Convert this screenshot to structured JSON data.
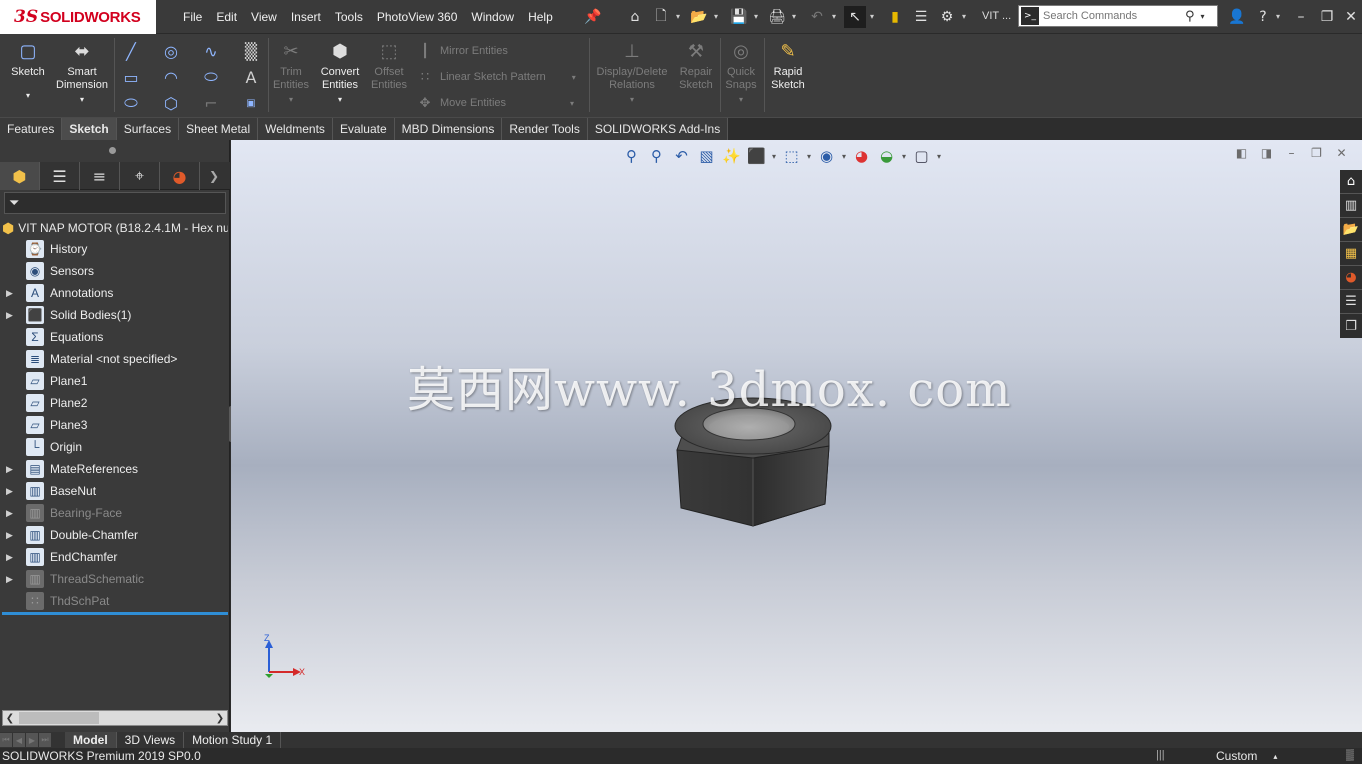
{
  "app": {
    "logo_ds": "3S",
    "logo_name": "SOLIDWORKS"
  },
  "menu": [
    "File",
    "Edit",
    "View",
    "Insert",
    "Tools",
    "PhotoView 360",
    "Window",
    "Help"
  ],
  "titlebar": {
    "doc_short": "VIT ...",
    "search_placeholder": "Search Commands"
  },
  "commands": {
    "sketch": "Sketch",
    "smart_dimension_1": "Smart",
    "smart_dimension_2": "Dimension",
    "trim_1": "Trim",
    "trim_2": "Entities",
    "convert_1": "Convert",
    "convert_2": "Entities",
    "offset_1": "Offset",
    "offset_2": "Entities",
    "mirror": "Mirror Entities",
    "linear_pattern": "Linear Sketch Pattern",
    "move": "Move Entities",
    "display_delete_1": "Display/Delete",
    "display_delete_2": "Relations",
    "repair_1": "Repair",
    "repair_2": "Sketch",
    "quick_snaps_1": "Quick",
    "quick_snaps_2": "Snaps",
    "rapid_1": "Rapid",
    "rapid_2": "Sketch"
  },
  "tabs": [
    {
      "label": "Features",
      "active": false
    },
    {
      "label": "Sketch",
      "active": true
    },
    {
      "label": "Surfaces",
      "active": false
    },
    {
      "label": "Sheet Metal",
      "active": false
    },
    {
      "label": "Weldments",
      "active": false
    },
    {
      "label": "Evaluate",
      "active": false
    },
    {
      "label": "MBD Dimensions",
      "active": false
    },
    {
      "label": "Render Tools",
      "active": false
    },
    {
      "label": "SOLIDWORKS Add-Ins",
      "active": false
    }
  ],
  "tree": {
    "root": "VIT NAP MOTOR  (B18.2.4.1M - Hex nu",
    "items": [
      {
        "label": "History",
        "icon": "history-icon",
        "expandable": false,
        "dim": false
      },
      {
        "label": "Sensors",
        "icon": "sensors-icon",
        "expandable": false,
        "dim": false
      },
      {
        "label": "Annotations",
        "icon": "annotations-icon",
        "expandable": true,
        "dim": false
      },
      {
        "label": "Solid Bodies(1)",
        "icon": "solid-bodies-icon",
        "expandable": true,
        "dim": false
      },
      {
        "label": "Equations",
        "icon": "equations-icon",
        "expandable": false,
        "dim": false
      },
      {
        "label": "Material <not specified>",
        "icon": "material-icon",
        "expandable": false,
        "dim": false
      },
      {
        "label": "Plane1",
        "icon": "plane-icon",
        "expandable": false,
        "dim": false
      },
      {
        "label": "Plane2",
        "icon": "plane-icon",
        "expandable": false,
        "dim": false
      },
      {
        "label": "Plane3",
        "icon": "plane-icon",
        "expandable": false,
        "dim": false
      },
      {
        "label": "Origin",
        "icon": "origin-icon",
        "expandable": false,
        "dim": false
      },
      {
        "label": "MateReferences",
        "icon": "folder-icon",
        "expandable": true,
        "dim": false
      },
      {
        "label": "BaseNut",
        "icon": "extrude-icon",
        "expandable": true,
        "dim": false
      },
      {
        "label": "Bearing-Face",
        "icon": "cut-icon",
        "expandable": true,
        "dim": true
      },
      {
        "label": "Double-Chamfer",
        "icon": "cut-icon",
        "expandable": true,
        "dim": false
      },
      {
        "label": "EndChamfer",
        "icon": "cut-icon",
        "expandable": true,
        "dim": false
      },
      {
        "label": "ThreadSchematic",
        "icon": "cut-icon",
        "expandable": true,
        "dim": true
      },
      {
        "label": "ThdSchPat",
        "icon": "pattern-icon",
        "expandable": false,
        "dim": true
      }
    ]
  },
  "viewport": {
    "watermark": "莫西网www. 3dmox. com",
    "triad_z": "Z",
    "triad_x": "X"
  },
  "bottom_tabs": [
    "Model",
    "3D Views",
    "Motion Study 1"
  ],
  "status": {
    "version": "SOLIDWORKS Premium 2019 SP0.0",
    "units": "Custom"
  }
}
